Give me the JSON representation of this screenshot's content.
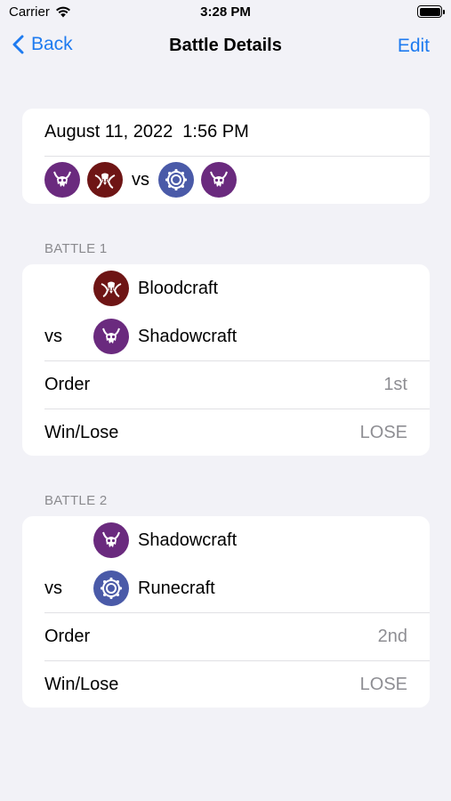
{
  "status_bar": {
    "carrier": "Carrier",
    "time": "3:28 PM"
  },
  "nav": {
    "back_label": "Back",
    "title": "Battle Details",
    "edit_label": "Edit"
  },
  "summary": {
    "datetime": "August 11, 2022  1:56 PM",
    "vs_label": "vs",
    "player_emblems": [
      "shadowcraft-emblem-icon",
      "bloodcraft-emblem-icon"
    ],
    "opponent_emblems": [
      "runecraft-emblem-icon",
      "shadowcraft-emblem-icon"
    ]
  },
  "battles": [
    {
      "header": "BATTLE 1",
      "player_class": "Bloodcraft",
      "vs_label": "vs",
      "opponent_class": "Shadowcraft",
      "order_label": "Order",
      "order_value": "1st",
      "result_label": "Win/Lose",
      "result_value": "LOSE"
    },
    {
      "header": "BATTLE 2",
      "player_class": "Shadowcraft",
      "vs_label": "vs",
      "opponent_class": "Runecraft",
      "order_label": "Order",
      "order_value": "2nd",
      "result_label": "Win/Lose",
      "result_value": "LOSE"
    }
  ],
  "colors": {
    "accent": "#1e7bf0",
    "shadowcraft": "#6a2a7e",
    "bloodcraft": "#6e1515",
    "runecraft": "#4a5aa8"
  }
}
